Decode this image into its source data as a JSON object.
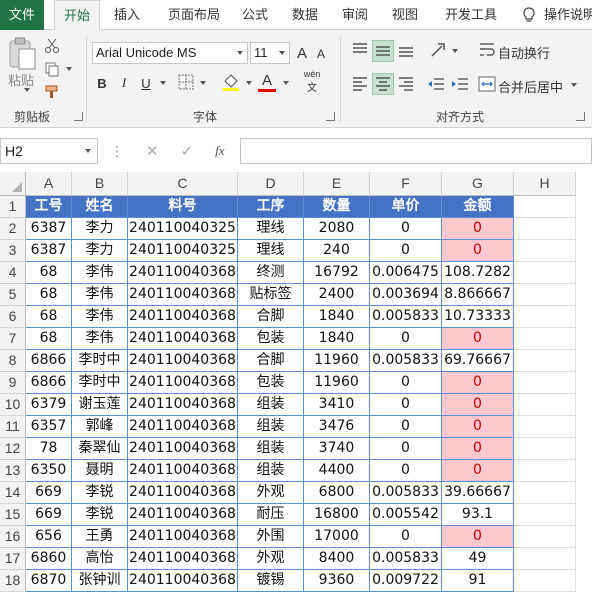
{
  "tabs": [
    {
      "label": "文件",
      "key": "file"
    },
    {
      "label": "开始",
      "key": "home"
    },
    {
      "label": "插入",
      "key": "insert"
    },
    {
      "label": "页面布局",
      "key": "layout"
    },
    {
      "label": "公式",
      "key": "formulas"
    },
    {
      "label": "数据",
      "key": "data"
    },
    {
      "label": "审阅",
      "key": "review"
    },
    {
      "label": "视图",
      "key": "view"
    },
    {
      "label": "开发工具",
      "key": "developer"
    }
  ],
  "tell_me": "操作说明",
  "ribbon": {
    "paste_label": "粘贴",
    "clipboard_label": "剪贴板",
    "font_group_label": "字体",
    "align_group_label": "对齐方式",
    "font_name": "Arial Unicode MS",
    "font_size": "11",
    "grow_font": "A",
    "shrink_font": "A",
    "bold": "B",
    "italic": "I",
    "underline": "U",
    "font_color_letter": "A",
    "phonetic": "wén",
    "wrap_text": "自动换行",
    "merge_center": "合并后居中"
  },
  "formula_bar": {
    "name_box": "H2",
    "fx": "fx",
    "formula": ""
  },
  "colors": {
    "excel_green": "#217346",
    "header_blue": "#4472c4",
    "pink_fill": "#ffc7ce",
    "pink_text": "#c00000"
  },
  "columns": [
    "A",
    "B",
    "C",
    "D",
    "E",
    "F",
    "G",
    "H"
  ],
  "header_row": [
    "工号",
    "姓名",
    "料号",
    "工序",
    "数量",
    "单价",
    "金额"
  ],
  "rows": [
    {
      "n": "2",
      "cells": [
        "6387",
        "李力",
        "240110040325",
        "理线",
        "2080",
        "0",
        "0"
      ],
      "pink": true
    },
    {
      "n": "3",
      "cells": [
        "6387",
        "李力",
        "240110040325",
        "理线",
        "240",
        "0",
        "0"
      ],
      "pink": true
    },
    {
      "n": "4",
      "cells": [
        "68",
        "李伟",
        "240110040368",
        "终测",
        "16792",
        "0.006475",
        "108.7282"
      ],
      "pink": false
    },
    {
      "n": "5",
      "cells": [
        "68",
        "李伟",
        "240110040368",
        "贴标签",
        "2400",
        "0.003694",
        "8.866667"
      ],
      "pink": false
    },
    {
      "n": "6",
      "cells": [
        "68",
        "李伟",
        "240110040368",
        "合脚",
        "1840",
        "0.005833",
        "10.73333"
      ],
      "pink": false
    },
    {
      "n": "7",
      "cells": [
        "68",
        "李伟",
        "240110040368",
        "包装",
        "1840",
        "0",
        "0"
      ],
      "pink": true
    },
    {
      "n": "8",
      "cells": [
        "6866",
        "李时中",
        "240110040368",
        "合脚",
        "11960",
        "0.005833",
        "69.76667"
      ],
      "pink": false
    },
    {
      "n": "9",
      "cells": [
        "6866",
        "李时中",
        "240110040368",
        "包装",
        "11960",
        "0",
        "0"
      ],
      "pink": true
    },
    {
      "n": "10",
      "cells": [
        "6379",
        "谢玉莲",
        "240110040368",
        "组装",
        "3410",
        "0",
        "0"
      ],
      "pink": true
    },
    {
      "n": "11",
      "cells": [
        "6357",
        "郭峰",
        "240110040368",
        "组装",
        "3476",
        "0",
        "0"
      ],
      "pink": true
    },
    {
      "n": "12",
      "cells": [
        "78",
        "秦翠仙",
        "240110040368",
        "组装",
        "3740",
        "0",
        "0"
      ],
      "pink": true
    },
    {
      "n": "13",
      "cells": [
        "6350",
        "聂明",
        "240110040368",
        "组装",
        "4400",
        "0",
        "0"
      ],
      "pink": true
    },
    {
      "n": "14",
      "cells": [
        "669",
        "李锐",
        "240110040368",
        "外观",
        "6800",
        "0.005833",
        "39.66667"
      ],
      "pink": false
    },
    {
      "n": "15",
      "cells": [
        "669",
        "李锐",
        "240110040368",
        "耐压",
        "16800",
        "0.005542",
        "93.1"
      ],
      "pink": false
    },
    {
      "n": "16",
      "cells": [
        "656",
        "王勇",
        "240110040368",
        "外围",
        "17000",
        "0",
        "0"
      ],
      "pink": true
    },
    {
      "n": "17",
      "cells": [
        "6860",
        "高怡",
        "240110040368",
        "外观",
        "8400",
        "0.005833",
        "49"
      ],
      "pink": false
    },
    {
      "n": "18",
      "cells": [
        "6870",
        "张钟训",
        "240110040368",
        "镀锡",
        "9360",
        "0.009722",
        "91"
      ],
      "pink": false
    }
  ]
}
